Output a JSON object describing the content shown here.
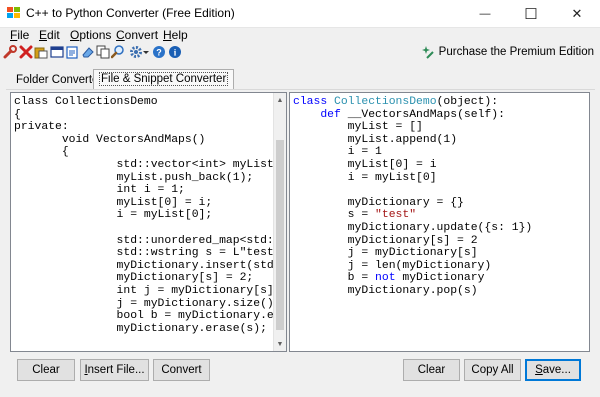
{
  "window": {
    "title": "C++ to Python Converter (Free Edition)",
    "minimize_glyph": "—",
    "maximize_glyph": "☐",
    "close_glyph": "✕"
  },
  "menu": {
    "items": [
      {
        "underline": "F",
        "rest": "ile"
      },
      {
        "underline": "E",
        "rest": "dit"
      },
      {
        "underline": "O",
        "rest": "ptions"
      },
      {
        "underline": "C",
        "rest": "onvert"
      },
      {
        "underline": "H",
        "rest": "elp"
      }
    ]
  },
  "toolbar": {
    "icons": [
      "wrench-icon",
      "delete-icon",
      "paste-icon",
      "window-icon",
      "clipboard-icon",
      "eraser-icon",
      "copy-icon",
      "find-icon",
      "settings-icon",
      "help-icon",
      "info-icon"
    ],
    "premium_label": "Purchase the Premium Edition"
  },
  "tabs": {
    "folder_converter": "Folder Converter",
    "file_snippet_converter": "File & Snippet Converter"
  },
  "source_code": [
    "class CollectionsDemo",
    "{",
    "private:",
    "       void VectorsAndMaps()",
    "       {",
    "               std::vector<int> myList = std::",
    "               myList.push_back(1);",
    "               int i = 1;",
    "               myList[0] = i;",
    "               i = myList[0];",
    "",
    "               std::unordered_map<std::wstring",
    "               std::wstring s = L\"test\";",
    "               myDictionary.insert(std::make_p",
    "               myDictionary[s] = 2;",
    "               int j = myDictionary[s];",
    "               j = myDictionary.size();",
    "               bool b = myDictionary.empty();",
    "               myDictionary.erase(s);"
  ],
  "python_code": [
    [
      {
        "t": "class",
        "c": "kw"
      },
      {
        "t": " "
      },
      {
        "t": "CollectionsDemo",
        "c": "cls"
      },
      {
        "t": "(object):"
      }
    ],
    [
      {
        "t": "    "
      },
      {
        "t": "def",
        "c": "kw"
      },
      {
        "t": " __VectorsAndMaps(self):"
      }
    ],
    [
      {
        "t": "        myList = []"
      }
    ],
    [
      {
        "t": "        myList.append(1)"
      }
    ],
    [
      {
        "t": "        i = 1"
      }
    ],
    [
      {
        "t": "        myList[0] = i"
      }
    ],
    [
      {
        "t": "        i = myList[0]"
      }
    ],
    [
      {
        "t": ""
      }
    ],
    [
      {
        "t": "        myDictionary = {}"
      }
    ],
    [
      {
        "t": "        s = "
      },
      {
        "t": "\"test\"",
        "c": "str"
      }
    ],
    [
      {
        "t": "        myDictionary.update({s: 1})"
      }
    ],
    [
      {
        "t": "        myDictionary[s] = 2"
      }
    ],
    [
      {
        "t": "        j = myDictionary[s]"
      }
    ],
    [
      {
        "t": "        j = len(myDictionary)"
      }
    ],
    [
      {
        "t": "        b = "
      },
      {
        "t": "not",
        "c": "kw"
      },
      {
        "t": " myDictionary"
      }
    ],
    [
      {
        "t": "        myDictionary.pop(s)"
      }
    ]
  ],
  "buttons": {
    "clear_left": {
      "underline": "",
      "rest": "Clear"
    },
    "insert_file": {
      "underline": "I",
      "rest": "nsert File..."
    },
    "convert": {
      "underline": "",
      "rest": "Convert"
    },
    "clear_right": {
      "underline": "",
      "rest": "Clear"
    },
    "copy_all": {
      "underline": "",
      "rest": "Copy All"
    },
    "save": {
      "underline": "S",
      "rest": "ave..."
    }
  },
  "colors": {
    "keyword": "#0000ff",
    "class_name": "#2b91af",
    "string": "#a31515",
    "default_button_border": "#0078d7"
  }
}
